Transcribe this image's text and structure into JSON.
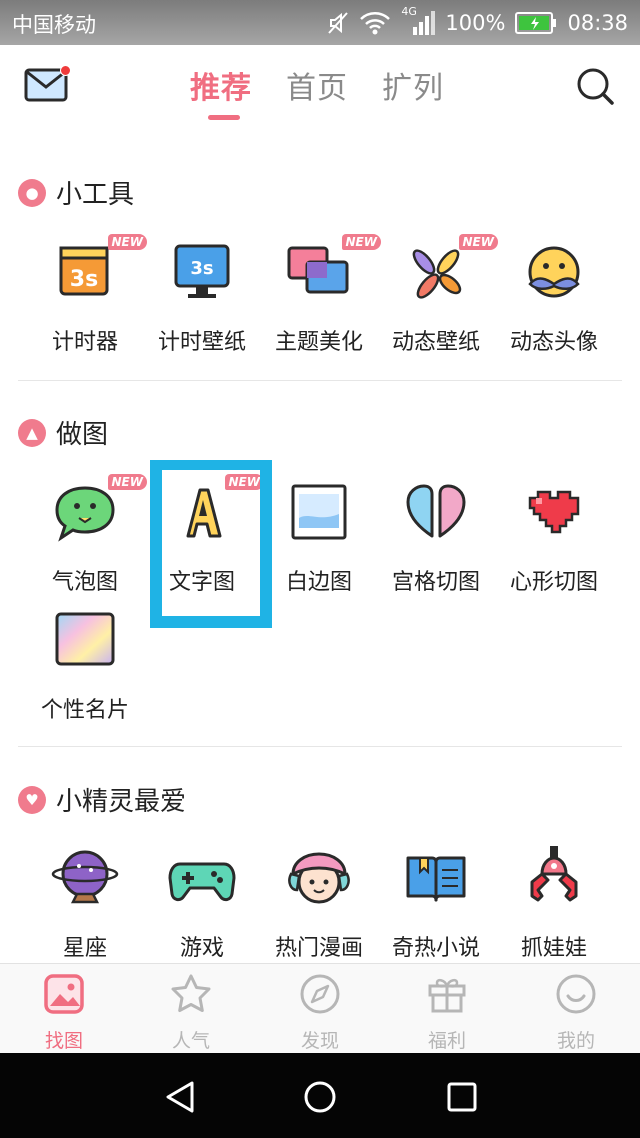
{
  "status_bar": {
    "carrier": "中国移动",
    "network": "4G",
    "battery_percent": "100%",
    "time": "08:38"
  },
  "top_nav": {
    "tabs": [
      {
        "label": "推荐",
        "active": true
      },
      {
        "label": "首页",
        "active": false
      },
      {
        "label": "扩列",
        "active": false
      }
    ]
  },
  "sections": {
    "tools": {
      "title": "小工具",
      "items": [
        {
          "label": "计时器",
          "icon": "calendar-timer-icon",
          "new": "NEW"
        },
        {
          "label": "计时壁纸",
          "icon": "monitor-timer-icon"
        },
        {
          "label": "主题美化",
          "icon": "theme-windows-icon",
          "new": "NEW"
        },
        {
          "label": "动态壁纸",
          "icon": "pinwheel-icon",
          "new": "NEW"
        },
        {
          "label": "动态头像",
          "icon": "mustache-face-icon"
        }
      ]
    },
    "make_pic": {
      "title": "做图",
      "items": [
        {
          "label": "气泡图",
          "icon": "speech-bubble-face-icon",
          "new": "NEW"
        },
        {
          "label": "文字图",
          "icon": "letter-a-icon",
          "new": "NEW"
        },
        {
          "label": "白边图",
          "icon": "white-border-picture-icon"
        },
        {
          "label": "宫格切图",
          "icon": "split-heart-icon"
        },
        {
          "label": "心形切图",
          "icon": "pixel-heart-icon"
        },
        {
          "label": "个性名片",
          "icon": "rainbow-card-icon"
        }
      ]
    },
    "favorites": {
      "title": "小精灵最爱",
      "items": [
        {
          "label": "星座",
          "icon": "crystal-ball-icon"
        },
        {
          "label": "游戏",
          "icon": "gamepad-icon"
        },
        {
          "label": "热门漫画",
          "icon": "cartoon-girl-icon"
        },
        {
          "label": "奇热小说",
          "icon": "open-book-icon"
        },
        {
          "label": "抓娃娃",
          "icon": "claw-machine-icon"
        }
      ]
    }
  },
  "tab_bar": [
    {
      "label": "找图",
      "icon": "picture-icon",
      "active": true
    },
    {
      "label": "人气",
      "icon": "star-icon",
      "active": false
    },
    {
      "label": "发现",
      "icon": "compass-icon",
      "active": false
    },
    {
      "label": "福利",
      "icon": "gift-icon",
      "active": false
    },
    {
      "label": "我的",
      "icon": "smile-icon",
      "active": false
    }
  ],
  "colors": {
    "accent": "#f06e81",
    "highlight_box": "#1fb3e5",
    "inactive": "#b6b6b6"
  }
}
